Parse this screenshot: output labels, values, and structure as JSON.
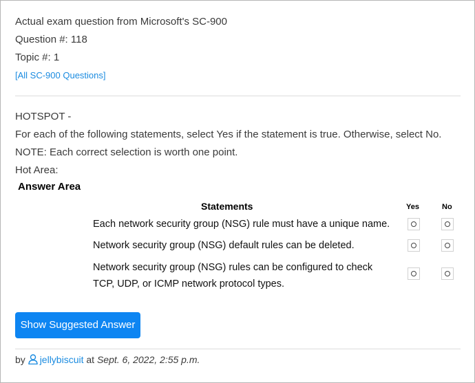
{
  "header": {
    "exam_line": "Actual exam question from Microsoft's SC-900",
    "question_line": "Question #: 118",
    "topic_line": "Topic #: 1",
    "all_questions_link": "[All SC-900 Questions]"
  },
  "question": {
    "type_line": "HOTSPOT -",
    "instruction": "For each of the following statements, select Yes if the statement is true. Otherwise, select No.",
    "note": "NOTE: Each correct selection is worth one point.",
    "hot_area": "Hot Area:"
  },
  "answer_area": {
    "title": "Answer Area",
    "statements_header": "Statements",
    "yes_header": "Yes",
    "no_header": "No",
    "statements": [
      {
        "line1": "Each network security group (NSG) rule must have a unique name.",
        "line2": ""
      },
      {
        "line1": "Network security group (NSG) default rules can be deleted.",
        "line2": ""
      },
      {
        "line1": "Network security group (NSG) rules can be configured to check",
        "line2": "TCP, UDP, or ICMP network protocol types."
      }
    ]
  },
  "actions": {
    "show_answer_label": "Show Suggested Answer"
  },
  "footer": {
    "by": "by",
    "username": "jellybiscuit",
    "at": "at",
    "date": "Sept. 6, 2022, 2:55 p.m."
  },
  "colors": {
    "accent": "#0d85f2",
    "link": "#1a8be0"
  }
}
